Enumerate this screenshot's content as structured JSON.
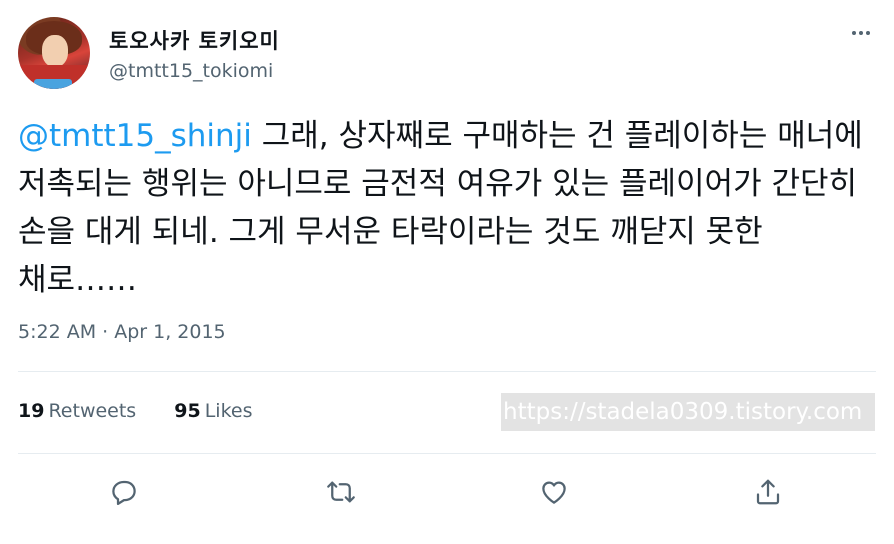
{
  "author": {
    "display_name": "토오사카 토키오미",
    "handle": "@tmtt15_tokiomi"
  },
  "tweet": {
    "mention": "@tmtt15_shinji",
    "text": " 그래, 상자째로 구매하는 건 플레이하는 매너에 저촉되는 행위는 아니므로 금전적 여유가 있는 플레이어가 간단히 손을 대게 되네. 그게 무서운 타락이라는 것도 깨닫지 못한 채로……",
    "timestamp": "5:22 AM · Apr 1, 2015"
  },
  "stats": {
    "retweets_count": "19",
    "retweets_label": "Retweets",
    "likes_count": "95",
    "likes_label": "Likes"
  },
  "watermark": "https://stadela0309.tistory.com",
  "icons": {
    "more": "more-dots-icon",
    "reply": "reply-icon",
    "retweet": "retweet-icon",
    "like": "heart-icon",
    "share": "share-icon"
  },
  "colors": {
    "link": "#1d9bf0",
    "secondary": "#536471",
    "text": "#0f1419"
  }
}
